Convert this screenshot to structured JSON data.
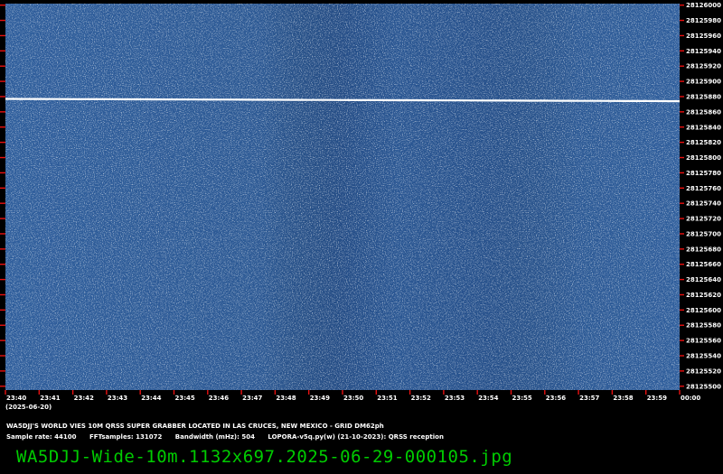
{
  "chart_data": {
    "type": "heatmap",
    "title": "",
    "xlabel": "",
    "ylabel": "",
    "date_label": "(2025-06-20)",
    "x_ticks": [
      "23:40",
      "23:41",
      "23:42",
      "23:43",
      "23:44",
      "23:45",
      "23:46",
      "23:47",
      "23:48",
      "23:49",
      "23:50",
      "23:51",
      "23:52",
      "23:53",
      "23:54",
      "23:55",
      "23:56",
      "23:57",
      "23:58",
      "23:59",
      "00:00"
    ],
    "y_ticks": [
      28126000,
      28125980,
      28125960,
      28125940,
      28125920,
      28125900,
      28125880,
      28125860,
      28125840,
      28125820,
      28125800,
      28125780,
      28125760,
      28125740,
      28125720,
      28125700,
      28125680,
      28125660,
      28125640,
      28125620,
      28125600,
      28125580,
      28125560,
      28125540,
      28125520,
      28125500
    ],
    "ylim": [
      28125495,
      28126002
    ],
    "xlim_minutes": [
      0,
      20
    ],
    "signal": {
      "start_minute": 0,
      "end_minute": 20,
      "frequency_start": 28125877,
      "frequency_end": 28125874
    },
    "colors": {
      "background": "#000000",
      "waterfall_base": "#2f5e9c",
      "waterfall_dark": "#1f4680",
      "signal": "#ffffff",
      "tick_marks": "#e81010",
      "caption": "#ffffff",
      "filename": "#00cc00"
    },
    "grid": false
  },
  "caption": {
    "station_line": "WA5DJJ'S WORLD VIES 10M QRSS SUPER GRABBER LOCATED IN LAS CRUCES, NEW MEXICO - GRID DM62ph",
    "sample_rate": "Sample rate: 44100",
    "fft_samples": "FFTsamples: 131072",
    "bandwidth": "Bandwidth (mHz): 504",
    "software": "LOPORA-v5q.py(w) (21-10-2023): QRSS reception"
  },
  "filename": "WA5DJJ-Wide-10m.1132x697.2025-06-29-000105.jpg"
}
